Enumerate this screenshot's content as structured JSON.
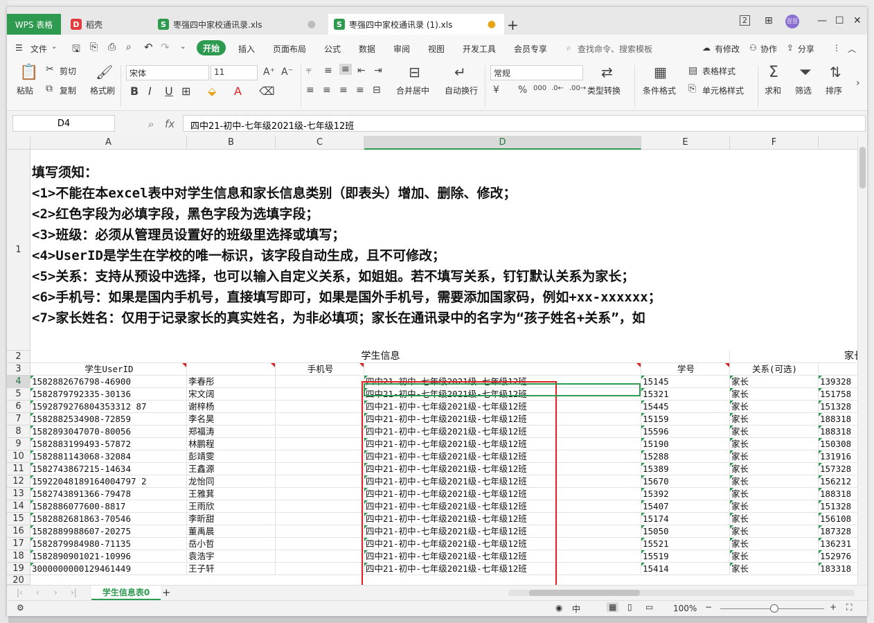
{
  "titlebar": {
    "tabs": [
      {
        "label": "WPS 表格"
      },
      {
        "label": "稻壳"
      },
      {
        "label": "枣强四中家校通讯录.xls"
      },
      {
        "label": "枣强四中家校通讯录 (1).xls"
      }
    ],
    "add_tab": "+",
    "layout_btn": "2",
    "grid_btn": "88",
    "avatar": "豆豆"
  },
  "menubar": {
    "file": "文件",
    "items": [
      "开始",
      "插入",
      "页面布局",
      "公式",
      "数据",
      "审阅",
      "视图",
      "开发工具",
      "会员专享"
    ],
    "search": "查找命令、搜索模板",
    "right": [
      "有修改",
      "协作",
      "分享"
    ]
  },
  "ribbon": {
    "paste": "粘贴",
    "cut": "剪切",
    "copy": "复制",
    "format_painter": "格式刷",
    "font_name": "宋体",
    "font_size": "11",
    "merge_center": "合并居中",
    "wrap": "自动换行",
    "number_format": "常规",
    "type_convert": "类型转换",
    "cond_format": "条件格式",
    "table_style": "表格样式",
    "cell_style": "单元格样式",
    "sum": "求和",
    "filter": "筛选",
    "sort": "排序"
  },
  "formula": {
    "name_box": "D4",
    "fx": "fx",
    "content": "四中21-初中-七年级2021级-七年级12班"
  },
  "columns": [
    "A",
    "B",
    "C",
    "D",
    "E",
    "F"
  ],
  "notes": [
    "填写须知：",
    " <1>不能在本excel表中对学生信息和家长信息类别（即表头）增加、删除、修改；",
    " <2>红色字段为必填字段，黑色字段为选填字段；",
    " <3>班级：必须从管理员设置好的班级里选择或填写；",
    " <4>UserID是学生在学校的唯一标识，该字段自动生成，且不可修改；",
    " <5>关系：支持从预设中选择，也可以输入自定义关系，如姐姐。若不填写关系，钉钉默认关系为家长；",
    " <6>手机号：如果是国内手机号，直接填写即可，如果是国外手机号，需要添加国家码，例如+xx-xxxxxx；",
    " <7>家长姓名：仅用于记录家长的真实姓名，为非必填项；家长在通讯录中的名字为“孩子姓名+关系”，如"
  ],
  "row2": {
    "student_info": "学生信息",
    "parent_info": "家长"
  },
  "headers": {
    "a": "学生UserID",
    "b": "",
    "c": "手机号",
    "d": "",
    "e": "学号",
    "f": "关系(可选)",
    "g": "手"
  },
  "rows": [
    {
      "n": "4",
      "id": "1582882676798-46900",
      "name": "李春彤",
      "cls": "四中21-初中-七年级2021级-七年级12班",
      "sid": "15145",
      "rel": "家长",
      "ph": "139328"
    },
    {
      "n": "5",
      "id": "1582879792335-30136",
      "name": "宋文阔",
      "cls": "四中21-初中-七年级2021级-七年级12班",
      "sid": "15321",
      "rel": "家长",
      "ph": "151758"
    },
    {
      "n": "6",
      "id": "1592879276804353312 87",
      "name": "谢梓杨",
      "cls": "四中21-初中-七年级2021级-七年级12班",
      "sid": "15445",
      "rel": "家长",
      "ph": "151328"
    },
    {
      "n": "7",
      "id": "1582882534908-72859",
      "name": "李名昊",
      "cls": "四中21-初中-七年级2021级-七年级12班",
      "sid": "15159",
      "rel": "家长",
      "ph": "188318"
    },
    {
      "n": "8",
      "id": "1582893047070-80056",
      "name": "郑福涛",
      "cls": "四中21-初中-七年级2021级-七年级12班",
      "sid": "15596",
      "rel": "家长",
      "ph": "188318"
    },
    {
      "n": "9",
      "id": "1582883199493-57872",
      "name": "林鹏程",
      "cls": "四中21-初中-七年级2021级-七年级12班",
      "sid": "15190",
      "rel": "家长",
      "ph": "150308"
    },
    {
      "n": "10",
      "id": "1582881143068-32084",
      "name": "彭靖雯",
      "cls": "四中21-初中-七年级2021级-七年级12班",
      "sid": "15288",
      "rel": "家长",
      "ph": "131916"
    },
    {
      "n": "11",
      "id": "1582743867215-14634",
      "name": "王鑫源",
      "cls": "四中21-初中-七年级2021级-七年级12班",
      "sid": "15389",
      "rel": "家长",
      "ph": "157328"
    },
    {
      "n": "12",
      "id": "15922048189164004797 2",
      "name": "龙怡同",
      "cls": "四中21-初中-七年级2021级-七年级12班",
      "sid": "15670",
      "rel": "家长",
      "ph": "156212"
    },
    {
      "n": "13",
      "id": "1582743891366-79478",
      "name": "王雅萁",
      "cls": "四中21-初中-七年级2021级-七年级12班",
      "sid": "15392",
      "rel": "家长",
      "ph": "188318"
    },
    {
      "n": "14",
      "id": "1582886077600-8817",
      "name": "王雨欣",
      "cls": "四中21-初中-七年级2021级-七年级12班",
      "sid": "15407",
      "rel": "家长",
      "ph": "151328"
    },
    {
      "n": "15",
      "id": "1582882681863-70546",
      "name": "李昕甜",
      "cls": "四中21-初中-七年级2021级-七年级12班",
      "sid": "15174",
      "rel": "家长",
      "ph": "156108"
    },
    {
      "n": "16",
      "id": "1582889988607-20275",
      "name": "董禹晨",
      "cls": "四中21-初中-七年级2021级-七年级12班",
      "sid": "15050",
      "rel": "家长",
      "ph": "187328"
    },
    {
      "n": "17",
      "id": "1582879984980-71135",
      "name": "岳小哲",
      "cls": "四中21-初中-七年级2021级-七年级12班",
      "sid": "15521",
      "rel": "家长",
      "ph": "136231"
    },
    {
      "n": "18",
      "id": "1582890901021-10996",
      "name": "袁浩宇",
      "cls": "四中21-初中-七年级2021级-七年级12班",
      "sid": "15519",
      "rel": "家长",
      "ph": "152976"
    },
    {
      "n": "19",
      "id": "3000000000129461449",
      "name": "王子轩",
      "cls": "四中21-初中-七年级2021级-七年级12班",
      "sid": "15414",
      "rel": "家长",
      "ph": "183318"
    }
  ],
  "sheetbar": {
    "sheet": "学生信息表0",
    "add": "+"
  },
  "statusbar": {
    "zoom": "100%",
    "lang": "中"
  }
}
